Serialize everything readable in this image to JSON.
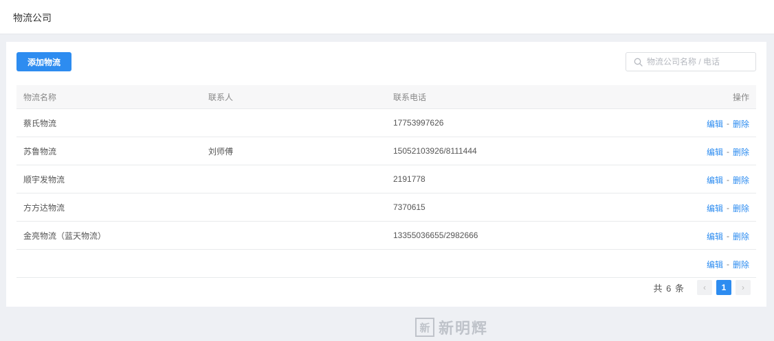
{
  "header": {
    "title": "物流公司"
  },
  "toolbar": {
    "add_label": "添加物流",
    "search_placeholder": "物流公司名称 / 电话"
  },
  "table": {
    "columns": [
      "物流名称",
      "联系人",
      "联系电话",
      "操作"
    ],
    "rows": [
      {
        "name": "蔡氏物流",
        "contact": "",
        "phone": "17753997626"
      },
      {
        "name": "苏鲁物流",
        "contact": "刘师傅",
        "phone": "15052103926/8111444"
      },
      {
        "name": "顺宇发物流",
        "contact": "",
        "phone": "2191778"
      },
      {
        "name": "方方达物流",
        "contact": "",
        "phone": "7370615"
      },
      {
        "name": "金亮物流（蓝天物流）",
        "contact": "",
        "phone": "13355036655/2982666"
      },
      {
        "name": "",
        "contact": "",
        "phone": ""
      }
    ],
    "actions": {
      "edit": "编辑",
      "separator": "-",
      "delete": "删除"
    }
  },
  "pagination": {
    "total_text": "共 6 条",
    "prev_icon": "‹",
    "next_icon": "›",
    "current_page": "1"
  },
  "watermark": {
    "seal": "新",
    "text": "新明辉"
  }
}
